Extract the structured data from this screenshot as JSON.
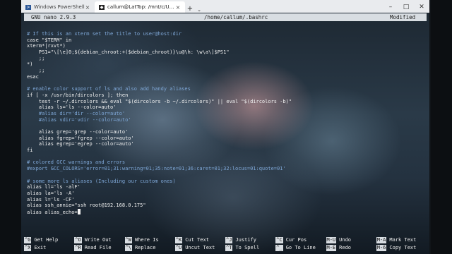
{
  "tabs": [
    {
      "title": "Windows PowerShell",
      "icon": "powershell-icon",
      "active": false
    },
    {
      "title": "callum@LatTop: /mnt/c/Users/C",
      "icon": "linux-penguin-icon",
      "active": true
    }
  ],
  "tab_controls": {
    "close": "×",
    "add": "+",
    "dropdown": "⌄"
  },
  "window_controls": {
    "minimize": "–",
    "maximize": "□",
    "close": "✕"
  },
  "nano": {
    "version": "GNU nano 2.9.3",
    "filename": "/home/callum/.bashrc",
    "status": "Modified"
  },
  "editor_lines": [
    {
      "text": "# If this is an xterm set the title to user@host:dir",
      "comment": true
    },
    {
      "text": "case \"$TERM\" in",
      "comment": false
    },
    {
      "text": "xterm*|rxvt*)",
      "comment": false
    },
    {
      "text": "    PS1=\"\\[\\e]0;${debian_chroot:+($debian_chroot)}\\u@\\h: \\w\\a\\]$PS1\"",
      "comment": false
    },
    {
      "text": "    ;;",
      "comment": false
    },
    {
      "text": "*)",
      "comment": false
    },
    {
      "text": "    ;;",
      "comment": false
    },
    {
      "text": "esac",
      "comment": false
    },
    {
      "text": "",
      "comment": false
    },
    {
      "text": "# enable color support of ls and also add handy aliases",
      "comment": true
    },
    {
      "text": "if [ -x /usr/bin/dircolors ]; then",
      "comment": false
    },
    {
      "text": "    test -r ~/.dircolors && eval \"$(dircolors -b ~/.dircolors)\" || eval \"$(dircolors -b)\"",
      "comment": false
    },
    {
      "text": "    alias ls='ls --color=auto'",
      "comment": false
    },
    {
      "text": "    #alias dir='dir --color=auto'",
      "comment": true
    },
    {
      "text": "    #alias vdir='vdir --color=auto'",
      "comment": true
    },
    {
      "text": "",
      "comment": false
    },
    {
      "text": "    alias grep='grep --color=auto'",
      "comment": false
    },
    {
      "text": "    alias fgrep='fgrep --color=auto'",
      "comment": false
    },
    {
      "text": "    alias egrep='egrep --color=auto'",
      "comment": false
    },
    {
      "text": "fi",
      "comment": false
    },
    {
      "text": "",
      "comment": false
    },
    {
      "text": "# colored GCC warnings and errors",
      "comment": true
    },
    {
      "text": "#export GCC_COLORS='error=01;31:warning=01;35:note=01;36:caret=01;32:locus=01:quote=01'",
      "comment": true
    },
    {
      "text": "",
      "comment": false
    },
    {
      "text": "# some more ls aliases (Including our custom ones)",
      "comment": true
    },
    {
      "text": "alias ll='ls -alF'",
      "comment": false
    },
    {
      "text": "alias la='ls -A'",
      "comment": false
    },
    {
      "text": "alias l='ls -CF'",
      "comment": false
    },
    {
      "text": "alias ssh_annie=\"ssh root@192.168.0.175\"",
      "comment": false
    },
    {
      "text": "alias alias_echo=",
      "comment": false,
      "cursor": true
    }
  ],
  "shortcuts": [
    {
      "key": "^G",
      "label": "Get Help"
    },
    {
      "key": "^O",
      "label": "Write Out"
    },
    {
      "key": "^W",
      "label": "Where Is"
    },
    {
      "key": "^K",
      "label": "Cut Text"
    },
    {
      "key": "^J",
      "label": "Justify"
    },
    {
      "key": "^C",
      "label": "Cur Pos"
    },
    {
      "key": "M-U",
      "label": "Undo"
    },
    {
      "key": "M-A",
      "label": "Mark Text"
    },
    {
      "key": "^X",
      "label": "Exit"
    },
    {
      "key": "^R",
      "label": "Read File"
    },
    {
      "key": "^\\",
      "label": "Replace"
    },
    {
      "key": "^U",
      "label": "Uncut Text"
    },
    {
      "key": "^T",
      "label": "To Spell"
    },
    {
      "key": "^_",
      "label": "Go To Line"
    },
    {
      "key": "M-E",
      "label": "Redo"
    },
    {
      "key": "M-6",
      "label": "Copy Text"
    }
  ],
  "colors": {
    "comment": "#7fa8d8",
    "text": "#f2f2f2",
    "bar": "#d8dde2"
  }
}
